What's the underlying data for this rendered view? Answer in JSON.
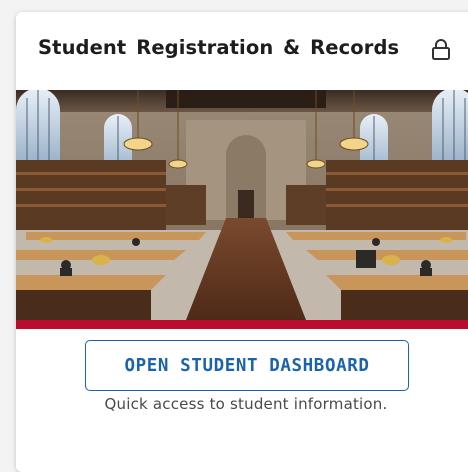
{
  "card": {
    "title": "Student Registration & Records",
    "lock_icon": "lock-icon",
    "image_icon": "library-reading-room-photo",
    "button_label": "OPEN STUDENT DASHBOARD",
    "caption": "Quick access to student information."
  },
  "colors": {
    "accent": "#ba0c2f",
    "button_text": "#1c63ad",
    "title": "#1d1d1d"
  }
}
